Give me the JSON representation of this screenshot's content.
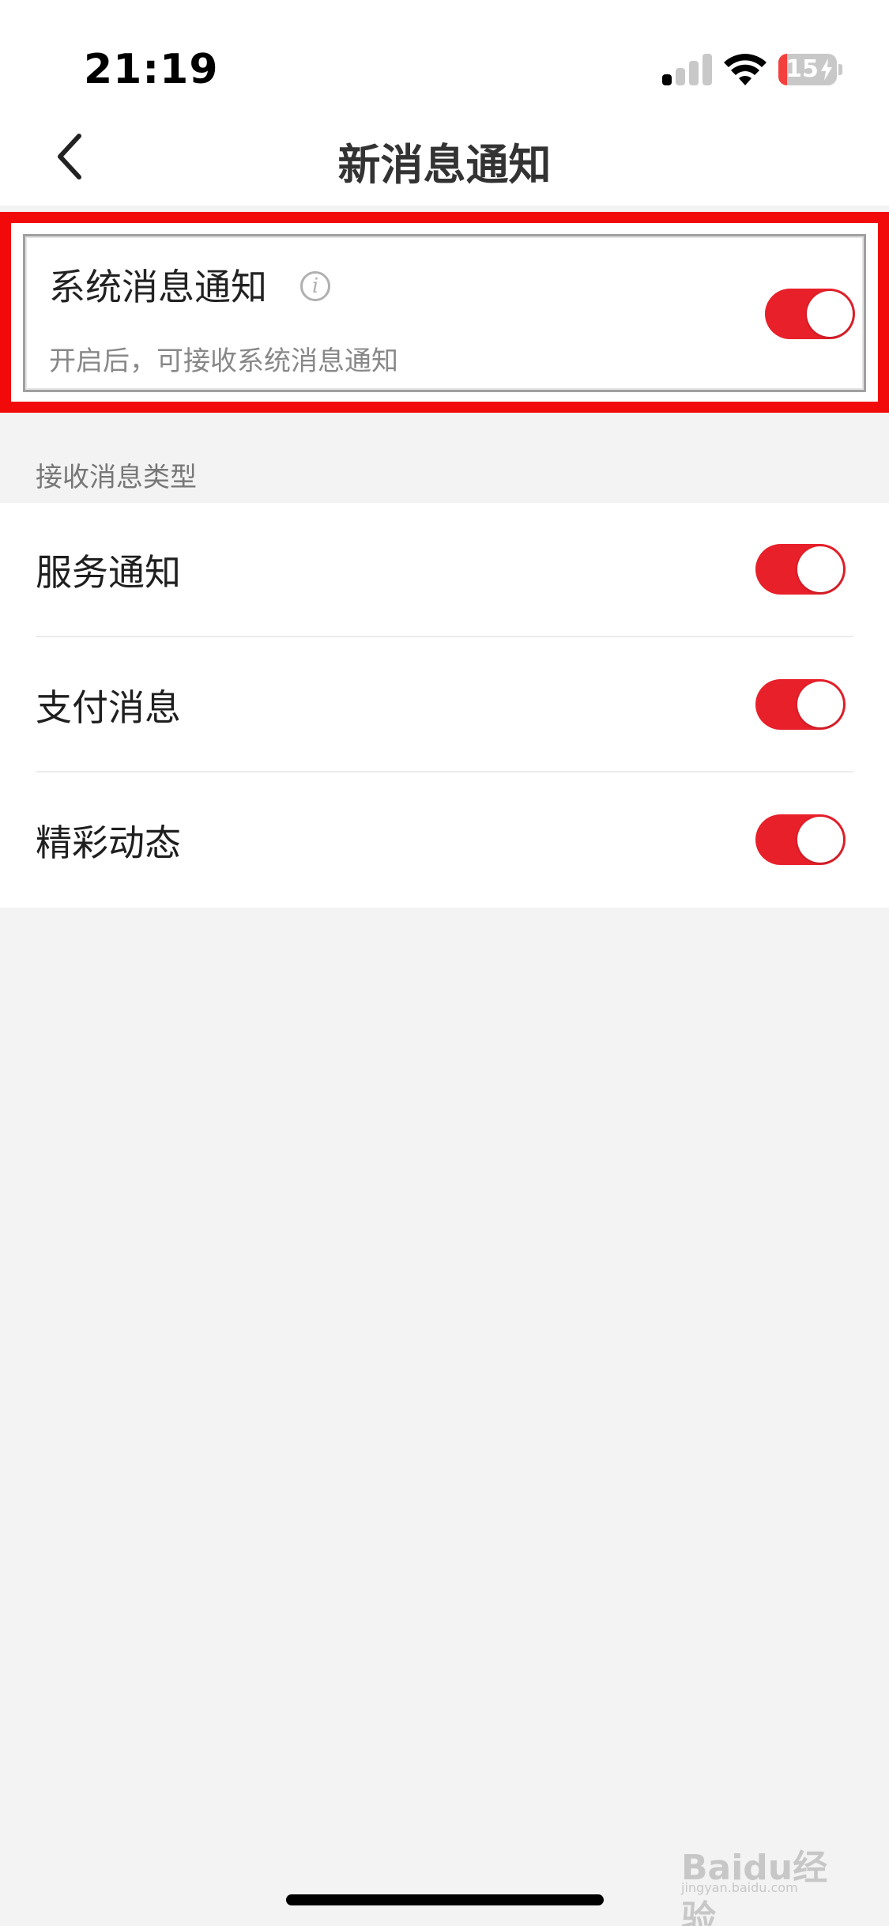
{
  "status_bar": {
    "time": "21:19",
    "battery_percent": "15",
    "battery_level": 0.15,
    "signal_bars": 1,
    "icons": [
      "signal-icon",
      "wifi-icon",
      "battery-icon",
      "charging-bolt-icon"
    ]
  },
  "nav": {
    "title": "新消息通知",
    "back_icon": "chevron-left-icon"
  },
  "system_notice": {
    "title": "系统消息通知",
    "description": "开启后，可接收系统消息通知",
    "info_icon_glyph": "i",
    "enabled": true,
    "highlight_color": "#f20a0a"
  },
  "section": {
    "label": "接收消息类型"
  },
  "items": [
    {
      "label": "服务通知",
      "enabled": true
    },
    {
      "label": "支付消息",
      "enabled": true
    },
    {
      "label": "精彩动态",
      "enabled": true
    }
  ],
  "watermark": {
    "brand": "Baidu经验",
    "sub": "jingyan.baidu.com"
  },
  "colors": {
    "accent": "#e8202a",
    "background": "#f3f3f3",
    "surface": "#ffffff"
  }
}
